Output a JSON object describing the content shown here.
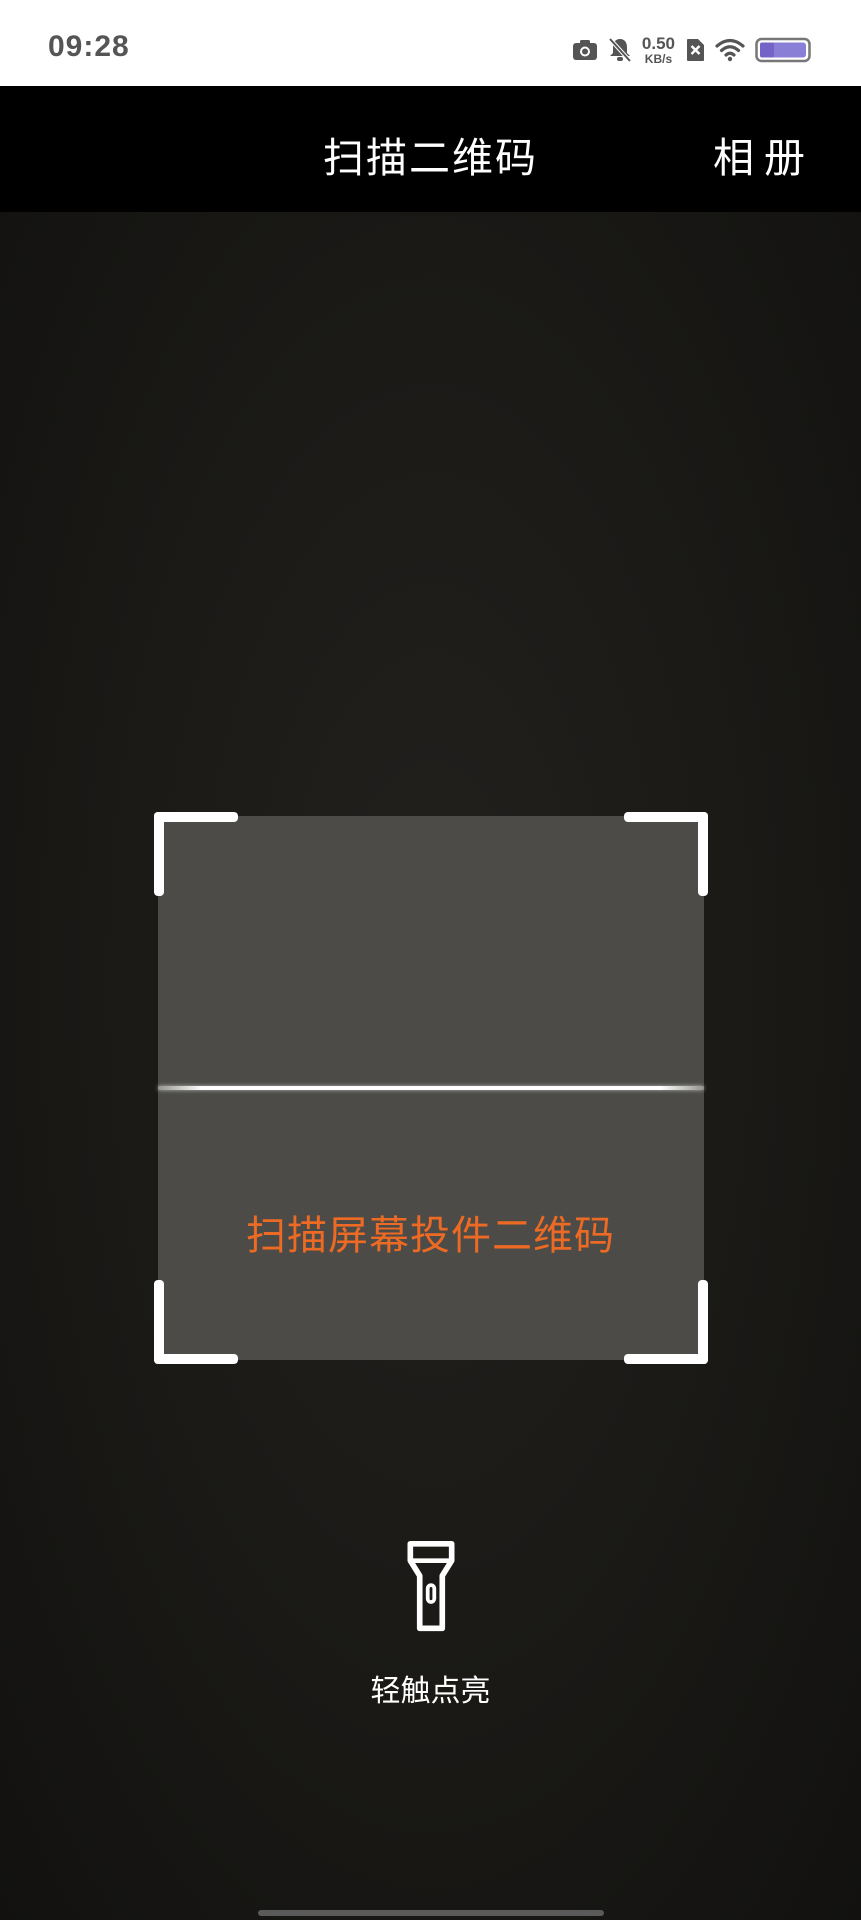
{
  "status_bar": {
    "time": "09:28",
    "net_speed_value": "0.50",
    "net_speed_unit": "KB/s",
    "icons": [
      "camera-icon",
      "bell-muted-icon",
      "sim-x-icon",
      "wifi-icon",
      "battery-icon"
    ],
    "battery_color": "#8a7fd6"
  },
  "app_bar": {
    "title": "扫描二维码",
    "album_label": "相册"
  },
  "scanner": {
    "hint": "扫描屏幕投件二维码",
    "hint_color": "#ec6a23",
    "frame_color": "#ffffff"
  },
  "torch": {
    "label": "轻触点亮",
    "icon": "flashlight-icon"
  }
}
